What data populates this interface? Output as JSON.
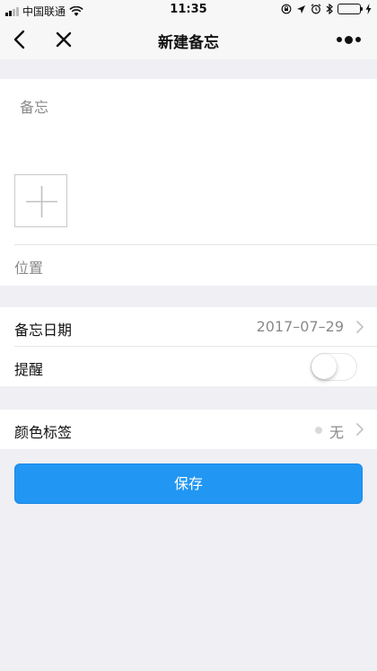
{
  "status_bar": {
    "carrier": "中国联通",
    "time": "11:35",
    "battery_color": "#4cd964",
    "icons": [
      "signal-icon",
      "wifi-icon",
      "lock-rotation-icon",
      "location-icon",
      "alarm-icon",
      "bluetooth-icon",
      "battery-icon",
      "charging-icon"
    ]
  },
  "nav": {
    "title": "新建备忘",
    "back_icon": "chevron-left-icon",
    "close_icon": "close-icon",
    "more_icon": "more-dots-icon"
  },
  "memo": {
    "placeholder": "备忘",
    "add_image_icon": "plus-icon",
    "location_placeholder": "位置"
  },
  "settings": {
    "date_label": "备忘日期",
    "date_value": "2017–07–29",
    "reminder_label": "提醒",
    "reminder_on": false
  },
  "tag": {
    "label": "颜色标签",
    "value": "无",
    "dot_color": "#d9d9d9"
  },
  "save": {
    "label": "保存",
    "color": "#2196f3"
  }
}
